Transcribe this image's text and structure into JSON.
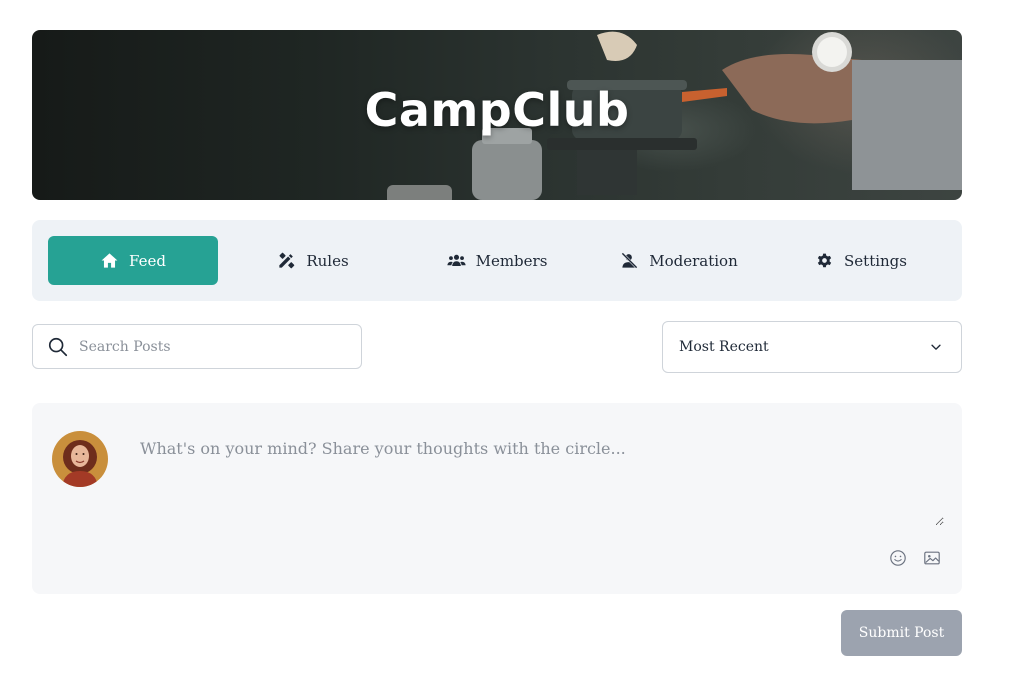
{
  "hero": {
    "title": "CampClub"
  },
  "nav": {
    "items": [
      {
        "label": "Feed",
        "icon": "home-icon",
        "active": true
      },
      {
        "label": "Rules",
        "icon": "rules-icon",
        "active": false
      },
      {
        "label": "Members",
        "icon": "members-icon",
        "active": false
      },
      {
        "label": "Moderation",
        "icon": "moderation-icon",
        "active": false
      },
      {
        "label": "Settings",
        "icon": "gear-icon",
        "active": false
      }
    ]
  },
  "search": {
    "placeholder": "Search Posts",
    "value": "",
    "icon": "search-icon"
  },
  "sort": {
    "selected": "Most Recent",
    "icon": "chevron-down-icon"
  },
  "composer": {
    "placeholder": "What's on your mind? Share your thoughts with the circle...",
    "value": "",
    "tools": [
      "emoji-icon",
      "image-icon"
    ]
  },
  "submit": {
    "label": "Submit Post"
  },
  "colors": {
    "accent": "#26a294",
    "nav_bg": "#eef2f6",
    "composer_bg": "#f6f7f9",
    "submit_bg": "#9ca3af"
  }
}
